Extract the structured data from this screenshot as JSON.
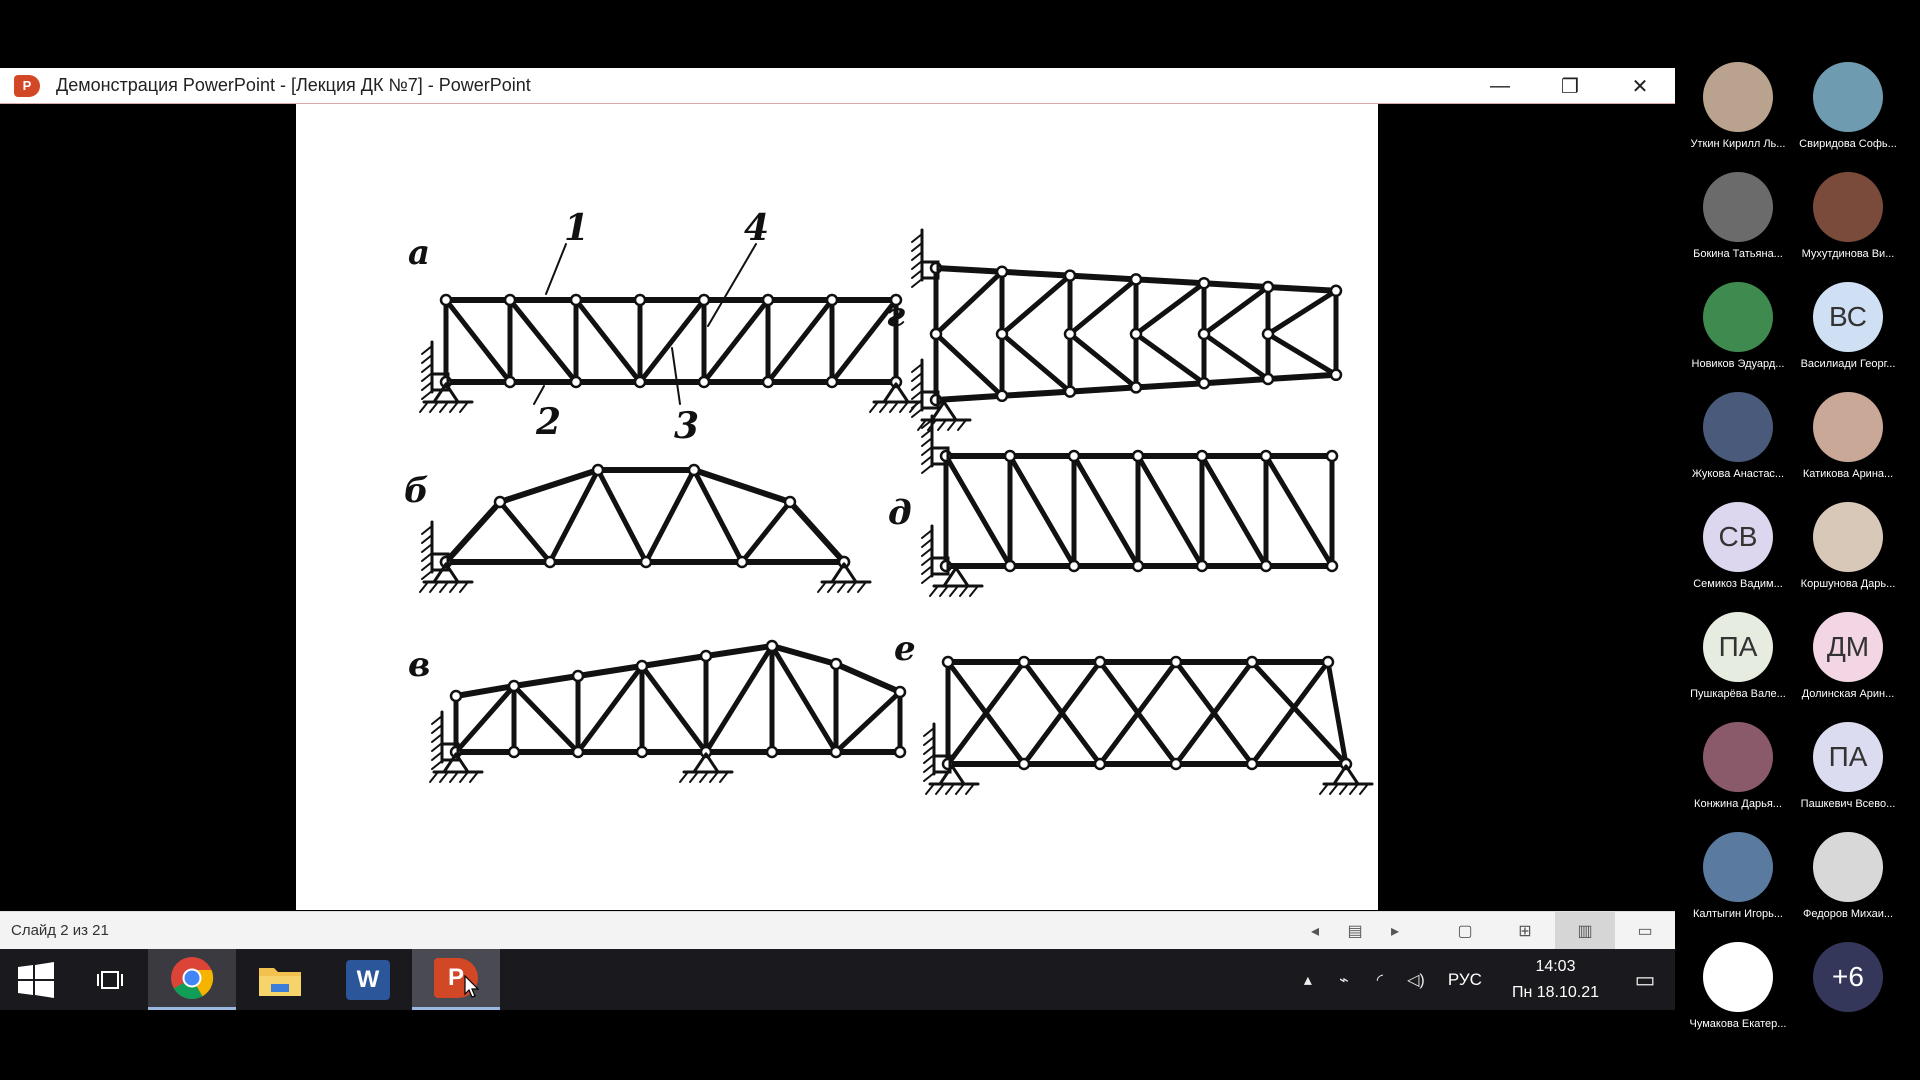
{
  "window": {
    "title": "Демонстрация PowerPoint - [Лекция ДК №7] - PowerPoint",
    "app_icon_letter": "P",
    "minimize": "—",
    "restore": "❐",
    "close": "✕"
  },
  "slide": {
    "labels": {
      "a": "а",
      "b": "б",
      "v": "в",
      "g": "г",
      "d": "д",
      "e": "е",
      "n1": "1",
      "n2": "2",
      "n3": "3",
      "n4": "4"
    }
  },
  "statusbar": {
    "slide_counter": "Слайд 2 из 21"
  },
  "taskbar": {
    "word_letter": "W",
    "ppt_letter": "P"
  },
  "tray": {
    "language": "РУС",
    "time": "14:03",
    "date": "Пн 18.10.21"
  },
  "participants": [
    {
      "name": "Уткин Кирилл Ль...",
      "initials": "",
      "color": "#b9a38f"
    },
    {
      "name": "Свиридова Софь...",
      "initials": "",
      "color": "#6f9bb0"
    },
    {
      "name": "Бокина Татьяна...",
      "initials": "",
      "color": "#6b6b6b"
    },
    {
      "name": "Мухутдинова Ви...",
      "initials": "",
      "color": "#7a4a3a"
    },
    {
      "name": "Новиков Эдуард...",
      "initials": "",
      "color": "#3f8a4f"
    },
    {
      "name": "Василиади Георг...",
      "initials": "ВС",
      "color": "#cfe0f5"
    },
    {
      "name": "Жукова Анастас...",
      "initials": "",
      "color": "#4a5a7a"
    },
    {
      "name": "Катикова Арина...",
      "initials": "",
      "color": "#caa898"
    },
    {
      "name": "Семикоз Вадим...",
      "initials": "СВ",
      "color": "#dcd6ee"
    },
    {
      "name": "Коршунова Дарь...",
      "initials": "",
      "color": "#d8c8b8"
    },
    {
      "name": "Пушкарёва Вале...",
      "initials": "ПА",
      "color": "#e6ede0"
    },
    {
      "name": "Долинская Арин...",
      "initials": "ДМ",
      "color": "#f3d6e4"
    },
    {
      "name": "Конжина Дарья...",
      "initials": "",
      "color": "#8a5a6a"
    },
    {
      "name": "Пашкевич Всево...",
      "initials": "ПА",
      "color": "#dcdcf0"
    },
    {
      "name": "Калтыгин Игорь...",
      "initials": "",
      "color": "#5a7aa0"
    },
    {
      "name": "Федоров Михаи...",
      "initials": "",
      "color": "#d8d8d8"
    },
    {
      "name": "Чумакова Екатер...",
      "initials": "",
      "color": "#ffffff"
    },
    {
      "name": "",
      "initials": "+6",
      "color": "#34375a"
    }
  ]
}
